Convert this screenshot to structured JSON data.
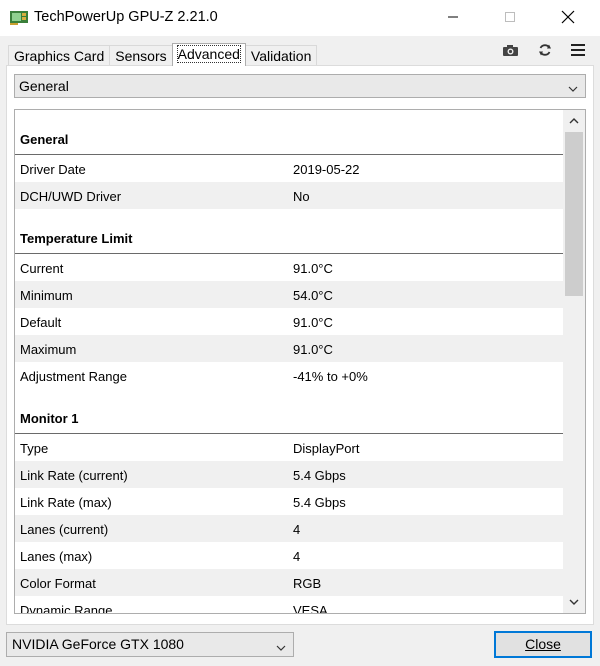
{
  "window": {
    "title": "TechPowerUp GPU-Z 2.21.0"
  },
  "tabs": [
    {
      "label": "Graphics Card",
      "active": false
    },
    {
      "label": "Sensors",
      "active": false
    },
    {
      "label": "Advanced",
      "active": true
    },
    {
      "label": "Validation",
      "active": false
    }
  ],
  "toolbar_icons": [
    "camera-icon",
    "refresh-icon",
    "hamburger-menu-icon"
  ],
  "category_select": {
    "value": "General"
  },
  "sections": [
    {
      "title": "General",
      "rows": [
        {
          "key": "Driver Date",
          "value": "2019-05-22"
        },
        {
          "key": "DCH/UWD Driver",
          "value": "No"
        }
      ]
    },
    {
      "title": "Temperature Limit",
      "rows": [
        {
          "key": "Current",
          "value": "91.0°C"
        },
        {
          "key": "Minimum",
          "value": "54.0°C"
        },
        {
          "key": "Default",
          "value": "91.0°C"
        },
        {
          "key": "Maximum",
          "value": "91.0°C"
        },
        {
          "key": "Adjustment Range",
          "value": "-41% to +0%"
        }
      ]
    },
    {
      "title": "Monitor 1",
      "rows": [
        {
          "key": "Type",
          "value": "DisplayPort"
        },
        {
          "key": "Link Rate (current)",
          "value": "5.4 Gbps"
        },
        {
          "key": "Link Rate (max)",
          "value": "5.4 Gbps"
        },
        {
          "key": "Lanes (current)",
          "value": "4"
        },
        {
          "key": "Lanes (max)",
          "value": "4"
        },
        {
          "key": "Color Format",
          "value": "RGB"
        },
        {
          "key": "Dynamic Range",
          "value": "VESA"
        }
      ]
    }
  ],
  "gpu_select": {
    "value": "NVIDIA GeForce GTX 1080"
  },
  "close_button": {
    "label": "Close"
  },
  "colors": {
    "accent": "#0078d7",
    "row_alt": "#f0f0f0"
  }
}
